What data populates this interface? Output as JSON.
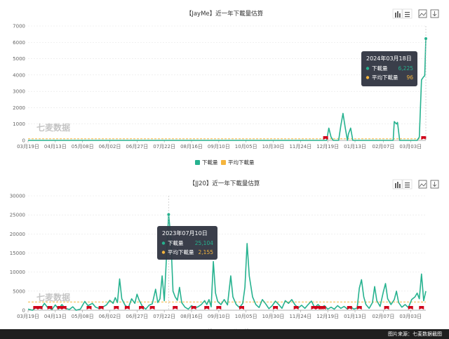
{
  "source_note": "图片来源：七麦数据截图",
  "watermark": "七麦数据",
  "colors": {
    "download": "#26b28f",
    "average": "#f5b53d",
    "marker": "#d0021b",
    "grid": "#e6e6e6",
    "tooltip_bg": "#2f3440"
  },
  "toolbar_icons": [
    "bar-chart-icon",
    "list-icon",
    "image-save-icon",
    "download-icon"
  ],
  "chart_data": [
    {
      "type": "line",
      "title": "【JayMe】近一年下載量估算",
      "ylim": [
        0,
        7000
      ],
      "yticks": [
        0,
        1000,
        2000,
        3000,
        4000,
        5000,
        6000,
        7000
      ],
      "xticks": [
        "03月19日",
        "04月13日",
        "05月08日",
        "06月02日",
        "06月27日",
        "07月22日",
        "08月16日",
        "09月10日",
        "10月05日",
        "10月30日",
        "11月24日",
        "12月19日",
        "01月13日",
        "02月07日",
        "03月03日"
      ],
      "n_points": 366,
      "legend": [
        "下載量",
        "平均下載量"
      ],
      "series": [
        {
          "name": "下載量",
          "points": [
            [
              0,
              0
            ],
            [
              274,
              0
            ],
            [
              276,
              750
            ],
            [
              278,
              200
            ],
            [
              280,
              0
            ],
            [
              285,
              0
            ],
            [
              287,
              900
            ],
            [
              289,
              1650
            ],
            [
              291,
              800
            ],
            [
              293,
              0
            ],
            [
              294,
              400
            ],
            [
              296,
              750
            ],
            [
              298,
              0
            ],
            [
              335,
              0
            ],
            [
              336,
              1150
            ],
            [
              338,
              1000
            ],
            [
              339,
              1100
            ],
            [
              341,
              0
            ],
            [
              357,
              0
            ],
            [
              359,
              200
            ],
            [
              361,
              3700
            ],
            [
              363,
              3900
            ],
            [
              364,
              3950
            ],
            [
              365,
              6225
            ]
          ]
        },
        {
          "name": "平均下載量",
          "value": 96
        }
      ],
      "markers": [
        273,
        363
      ],
      "tooltip": {
        "date": "2024年03月18日",
        "rows": [
          {
            "label": "下載量",
            "value": "6,225"
          },
          {
            "label": "平均下載量",
            "value": "96"
          }
        ]
      }
    },
    {
      "type": "line",
      "title": "【JJ20】近一年下載量估算",
      "ylim": [
        0,
        30000
      ],
      "yticks": [
        0,
        5000,
        10000,
        15000,
        20000,
        25000,
        30000
      ],
      "xticks": [
        "03月19日",
        "04月13日",
        "05月08日",
        "06月02日",
        "06月27日",
        "07月22日",
        "08月16日",
        "09月10日",
        "10月05日",
        "10月30日",
        "11月24日",
        "12月19日",
        "01月13日",
        "02月07日",
        "03月03日"
      ],
      "n_points": 366,
      "legend": [
        "下載量",
        "平均下載量"
      ],
      "series": [
        {
          "name": "下載量",
          "points": [
            [
              0,
              300
            ],
            [
              4,
              0
            ],
            [
              8,
              800
            ],
            [
              12,
              400
            ],
            [
              15,
              1800
            ],
            [
              18,
              700
            ],
            [
              22,
              200
            ],
            [
              25,
              1400
            ],
            [
              28,
              300
            ],
            [
              31,
              1500
            ],
            [
              34,
              500
            ],
            [
              38,
              200
            ],
            [
              41,
              900
            ],
            [
              44,
              0
            ],
            [
              48,
              300
            ],
            [
              52,
              2300
            ],
            [
              55,
              1200
            ],
            [
              59,
              1800
            ],
            [
              62,
              800
            ],
            [
              66,
              400
            ],
            [
              69,
              900
            ],
            [
              72,
              1400
            ],
            [
              75,
              2600
            ],
            [
              78,
              1800
            ],
            [
              80,
              3300
            ],
            [
              82,
              2000
            ],
            [
              84,
              8200
            ],
            [
              86,
              3000
            ],
            [
              89,
              1300
            ],
            [
              92,
              600
            ],
            [
              95,
              3000
            ],
            [
              98,
              1800
            ],
            [
              100,
              4200
            ],
            [
              102,
              2600
            ],
            [
              105,
              1000
            ],
            [
              108,
              300
            ],
            [
              111,
              1300
            ],
            [
              114,
              1700
            ],
            [
              117,
              5500
            ],
            [
              119,
              2000
            ],
            [
              121,
              3000
            ],
            [
              123,
              9000
            ],
            [
              125,
              2500
            ],
            [
              127,
              14000
            ],
            [
              129,
              25104
            ],
            [
              131,
              19000
            ],
            [
              133,
              5000
            ],
            [
              135,
              3500
            ],
            [
              137,
              2600
            ],
            [
              139,
              6000
            ],
            [
              141,
              2000
            ],
            [
              144,
              800
            ],
            [
              147,
              300
            ],
            [
              150,
              1200
            ],
            [
              153,
              600
            ],
            [
              156,
              900
            ],
            [
              159,
              1500
            ],
            [
              162,
              2500
            ],
            [
              164,
              1500
            ],
            [
              166,
              2800
            ],
            [
              168,
              900
            ],
            [
              170,
              12800
            ],
            [
              172,
              4500
            ],
            [
              174,
              2300
            ],
            [
              177,
              1500
            ],
            [
              180,
              2800
            ],
            [
              183,
              1400
            ],
            [
              186,
              9000
            ],
            [
              188,
              3500
            ],
            [
              191,
              1500
            ],
            [
              194,
              700
            ],
            [
              197,
              1800
            ],
            [
              199,
              6000
            ],
            [
              201,
              17500
            ],
            [
              203,
              9000
            ],
            [
              206,
              3500
            ],
            [
              209,
              1500
            ],
            [
              212,
              700
            ],
            [
              215,
              2800
            ],
            [
              218,
              1700
            ],
            [
              221,
              400
            ],
            [
              224,
              1200
            ],
            [
              227,
              2400
            ],
            [
              230,
              1500
            ],
            [
              233,
              500
            ],
            [
              236,
              2500
            ],
            [
              239,
              1800
            ],
            [
              242,
              2800
            ],
            [
              245,
              1400
            ],
            [
              248,
              600
            ],
            [
              251,
              1300
            ],
            [
              254,
              500
            ],
            [
              257,
              1500
            ],
            [
              260,
              2400
            ],
            [
              263,
              700
            ],
            [
              266,
              1500
            ],
            [
              269,
              700
            ],
            [
              272,
              1200
            ],
            [
              275,
              300
            ],
            [
              278,
              800
            ],
            [
              281,
              300
            ],
            [
              284,
              1200
            ],
            [
              287,
              500
            ],
            [
              290,
              1000
            ],
            [
              293,
              300
            ],
            [
              296,
              900
            ],
            [
              299,
              300
            ],
            [
              302,
              600
            ],
            [
              304,
              5800
            ],
            [
              306,
              8000
            ],
            [
              308,
              3500
            ],
            [
              310,
              1500
            ],
            [
              313,
              500
            ],
            [
              316,
              2000
            ],
            [
              318,
              6200
            ],
            [
              320,
              2500
            ],
            [
              323,
              1000
            ],
            [
              326,
              4800
            ],
            [
              328,
              7000
            ],
            [
              330,
              3000
            ],
            [
              333,
              1500
            ],
            [
              336,
              2800
            ],
            [
              338,
              5000
            ],
            [
              340,
              2000
            ],
            [
              343,
              800
            ],
            [
              346,
              1500
            ],
            [
              349,
              700
            ],
            [
              352,
              2800
            ],
            [
              355,
              3500
            ],
            [
              357,
              4500
            ],
            [
              359,
              3000
            ],
            [
              361,
              9500
            ],
            [
              363,
              2500
            ],
            [
              365,
              5000
            ]
          ]
        },
        {
          "name": "平均下載量",
          "value": 2155
        }
      ],
      "markers": [
        7,
        11,
        20,
        29,
        33,
        56,
        67,
        81,
        91,
        104,
        114,
        135,
        152,
        164,
        175,
        196,
        227,
        246,
        262,
        266,
        269,
        271,
        295,
        304,
        329,
        351,
        361
      ],
      "tooltip": {
        "date": "2023年07月10日",
        "rows": [
          {
            "label": "下載量",
            "value": "25,104"
          },
          {
            "label": "平均下載量",
            "value": "2,155"
          }
        ]
      }
    }
  ]
}
